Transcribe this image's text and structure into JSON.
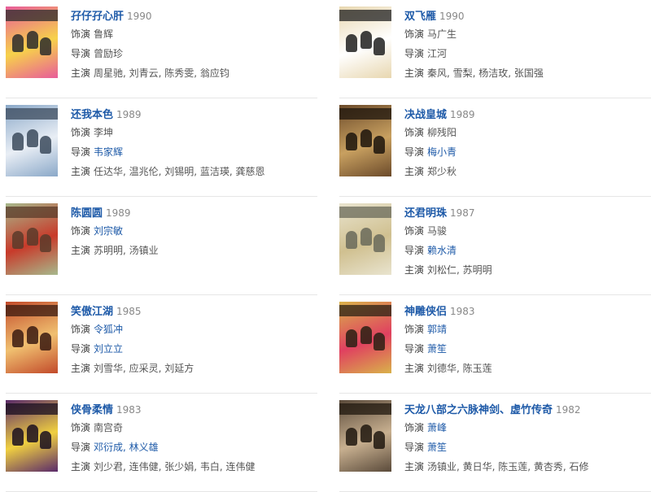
{
  "labels": {
    "role": "饰演",
    "director": "导演",
    "stars": "主演"
  },
  "colors": {
    "title_link": "#1e5aa8",
    "meta_text": "#555555",
    "divider": "#e6e6e6"
  },
  "movies": [
    {
      "title": "孖仔孖心肝",
      "year": "1990",
      "role": "鲁辉",
      "role_link": false,
      "director": "曾励珍",
      "director_link": false,
      "stars": "周星驰, 刘青云, 陈秀雯, 翁应钧",
      "poster": {
        "bg": "#e85c9a",
        "accent": "#f7d24a",
        "figure": "#2b2b2b"
      }
    },
    {
      "title": "双飞雁",
      "year": "1990",
      "role": "马广生",
      "role_link": false,
      "director": "江河",
      "director_link": false,
      "stars": "秦风, 雪梨, 杨洁玫, 张国强",
      "poster": {
        "bg": "#e8d7b0",
        "accent": "#ffffff",
        "figure": "#1f1f1f"
      }
    },
    {
      "title": "还我本色",
      "year": "1989",
      "role": "李坤",
      "role_link": false,
      "director": "韦家辉",
      "director_link": true,
      "stars": "任达华, 温兆伦, 刘锡明, 蓝洁瑛, 龚慈恩",
      "poster": {
        "bg": "#8aa8c8",
        "accent": "#e9eef5",
        "figure": "#3b4a5c"
      }
    },
    {
      "title": "决战皇城",
      "year": "1989",
      "role": "柳残阳",
      "role_link": false,
      "director": "梅小青",
      "director_link": true,
      "stars": "郑少秋",
      "poster": {
        "bg": "#6b4a2a",
        "accent": "#c8a060",
        "figure": "#1c140c"
      }
    },
    {
      "title": "陈圆圆",
      "year": "1989",
      "role": "刘宗敏",
      "role_link": true,
      "director": "",
      "director_link": false,
      "stars": "苏明明, 汤镇业",
      "poster": {
        "bg": "#a7b98c",
        "accent": "#c83a2a",
        "figure": "#5a3b2a"
      }
    },
    {
      "title": "还君明珠",
      "year": "1987",
      "role": "马骏",
      "role_link": false,
      "director": "赖水清",
      "director_link": true,
      "stars": "刘松仁, 苏明明",
      "poster": {
        "bg": "#e9e4cf",
        "accent": "#d0c090",
        "figure": "#6a6a5a"
      }
    },
    {
      "title": "笑傲江湖",
      "year": "1985",
      "role": "令狐冲",
      "role_link": true,
      "director": "刘立立",
      "director_link": true,
      "stars": "刘雪华, 应采灵, 刘延方",
      "poster": {
        "bg": "#c24a2a",
        "accent": "#f0c070",
        "figure": "#3a1a10"
      }
    },
    {
      "title": "神雕侠侣",
      "year": "1983",
      "role": "郭靖",
      "role_link": true,
      "director": "萧笙",
      "director_link": true,
      "stars": "刘德华, 陈玉莲",
      "poster": {
        "bg": "#d9b24a",
        "accent": "#e04060",
        "figure": "#2a2014"
      }
    },
    {
      "title": "侠骨柔情",
      "year": "1983",
      "role": "南宫奇",
      "role_link": false,
      "director": "邓衍成, 林义雄",
      "director_link": true,
      "stars": "刘少君, 连伟健, 张少娟, 韦白, 连伟健",
      "poster": {
        "bg": "#5a2a6a",
        "accent": "#f0d040",
        "figure": "#1a0f20"
      }
    },
    {
      "title": "天龙八部之六脉神剑、虚竹传奇",
      "year": "1982",
      "role": "萧峰",
      "role_link": true,
      "director": "萧笙",
      "director_link": true,
      "stars": "汤镇业, 黄日华, 陈玉莲, 黄杏秀, 石修",
      "poster": {
        "bg": "#5a4a3a",
        "accent": "#c8b090",
        "figure": "#20180f"
      }
    }
  ]
}
